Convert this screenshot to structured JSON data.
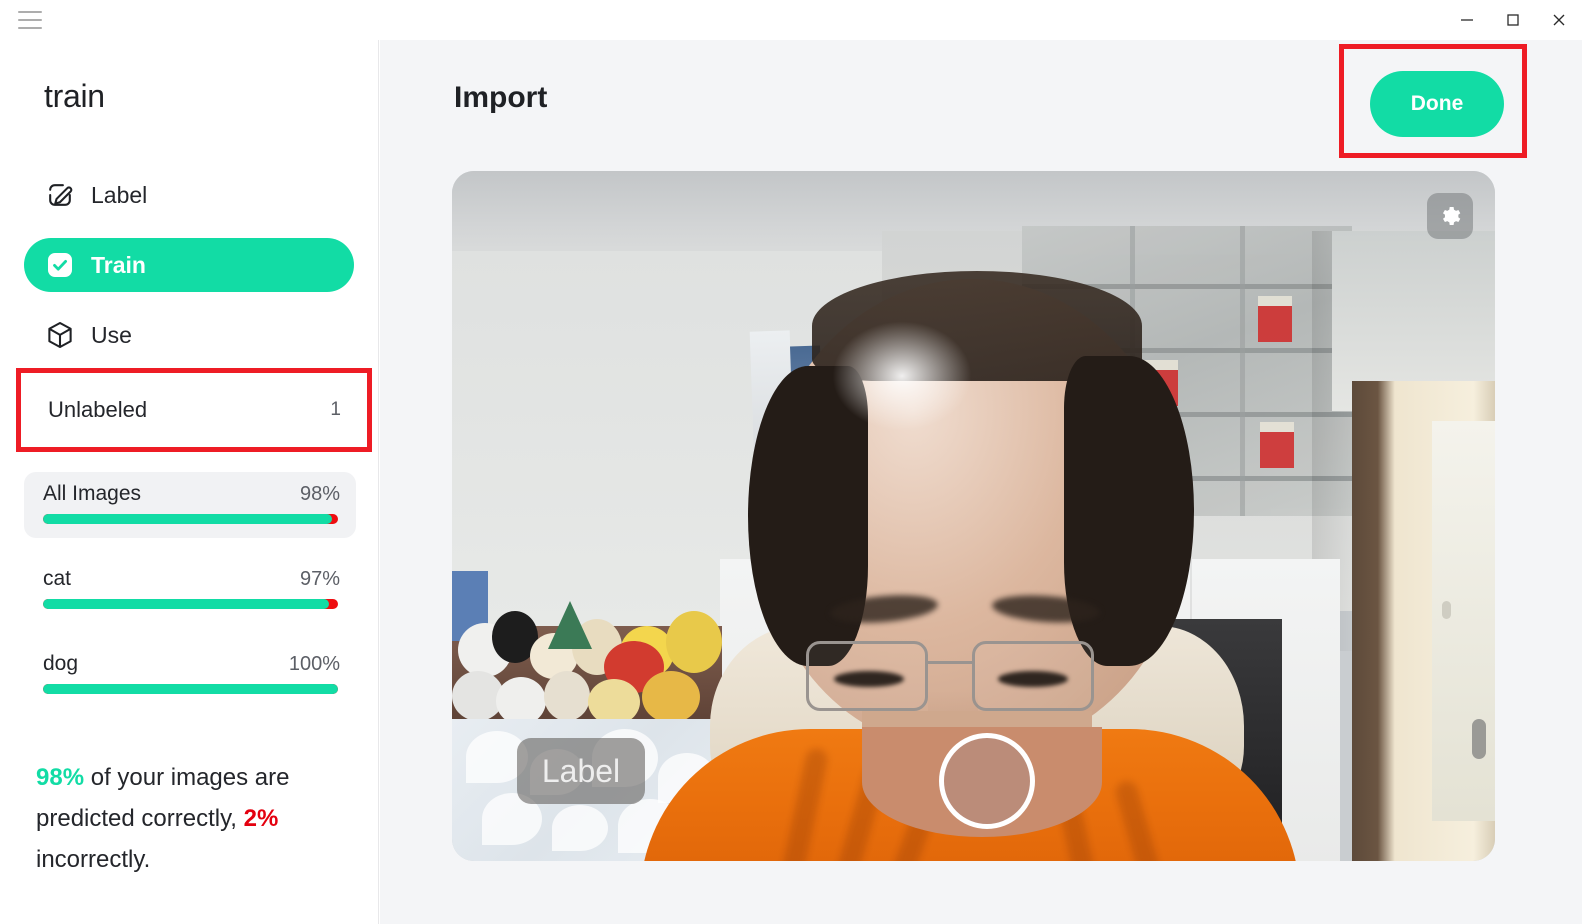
{
  "window": {
    "controls": {
      "menu": "hamburger-menu",
      "minimize": "minimize",
      "maximize": "maximize",
      "close": "close"
    }
  },
  "sidebar": {
    "project_title": "train",
    "nav": [
      {
        "id": "label",
        "label": "Label",
        "icon": "pencil-square-icon",
        "active": false
      },
      {
        "id": "train",
        "label": "Train",
        "icon": "check-square-icon",
        "active": true
      },
      {
        "id": "use",
        "label": "Use",
        "icon": "cube-icon",
        "active": false
      }
    ],
    "unlabeled": {
      "label": "Unlabeled",
      "count": "1"
    },
    "classes": [
      {
        "name": "All Images",
        "percent_label": "98%",
        "percent": 98,
        "highlight": true
      },
      {
        "name": "cat",
        "percent_label": "97%",
        "percent": 97,
        "highlight": false
      },
      {
        "name": "dog",
        "percent_label": "100%",
        "percent": 100,
        "highlight": false
      }
    ],
    "summary": {
      "correct_pct": "98%",
      "correct_text": " of your images are predicted correctly,",
      "incorrect_pct": "2%",
      "incorrect_text": " incorrectly."
    }
  },
  "main": {
    "title": "Import",
    "done_button": "Done",
    "preview": {
      "gear_icon": "gear-icon",
      "label_chip": "Label",
      "capture_button": "capture-button"
    }
  },
  "colors": {
    "accent_green": "#12DCA5",
    "error_red": "#e4000f",
    "annotation_red": "#ee1c25",
    "text_primary": "#24262b",
    "text_secondary": "#5c5f66",
    "sidebar_bg": "#ffffff",
    "main_bg": "#f4f5f7"
  }
}
